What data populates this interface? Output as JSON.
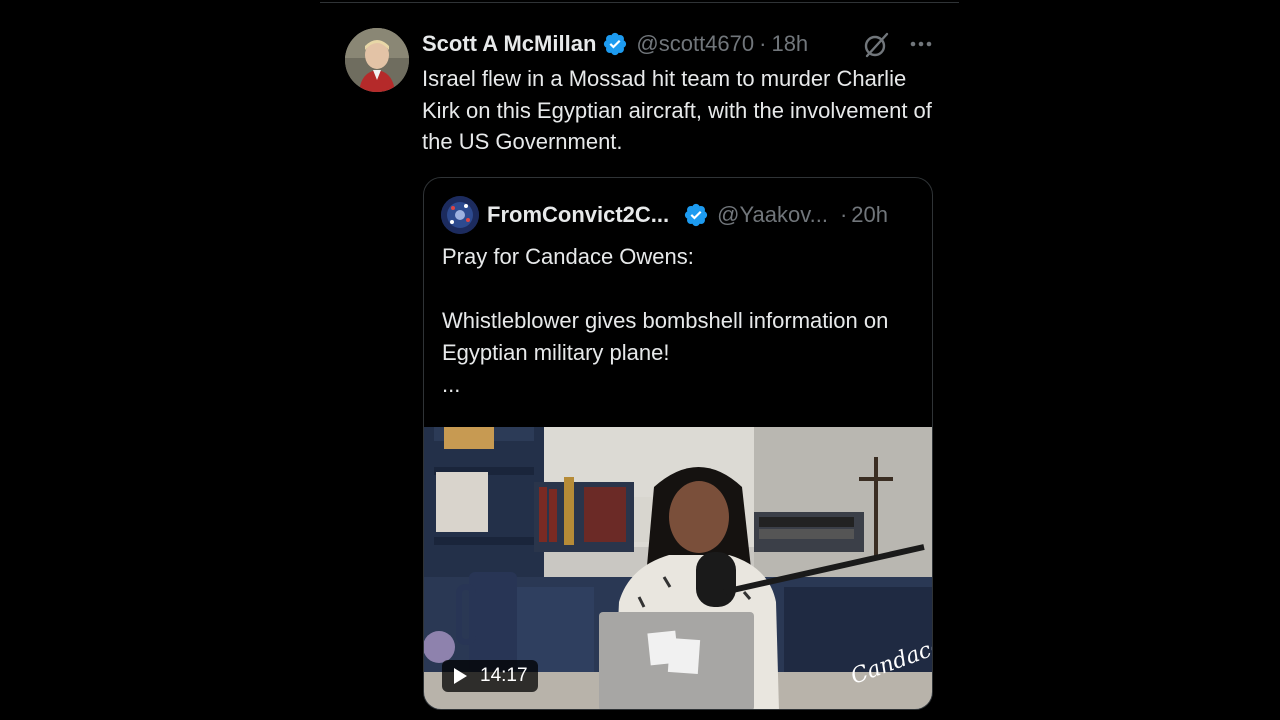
{
  "post": {
    "author": {
      "display_name": "Scott A McMillan",
      "handle": "@scott4670",
      "dot": "·",
      "time": "18h",
      "verified": true
    },
    "text": "Israel flew in a Mossad hit team to murder Charlie Kirk on this Egyptian aircraft, with the involvement of the US Government.",
    "icons": {
      "grok": "grok-icon",
      "more": "more-icon",
      "verified": "verified-badge-icon"
    }
  },
  "quote": {
    "author": {
      "display_name": "FromConvict2C...",
      "handle": "@Yaakov...",
      "dot": "·",
      "time": "20h",
      "verified": true
    },
    "text_lines": [
      "Pray for Candace Owens:",
      "Whistleblower gives bombshell information on Egyptian military plane!",
      "..."
    ],
    "video": {
      "duration": "14:17",
      "signature": "Candace"
    }
  },
  "colors": {
    "background": "#000000",
    "text_primary": "#e7e9ea",
    "text_secondary": "#71767b",
    "border": "#2f3336",
    "verified_blue": "#1d9bf0"
  }
}
